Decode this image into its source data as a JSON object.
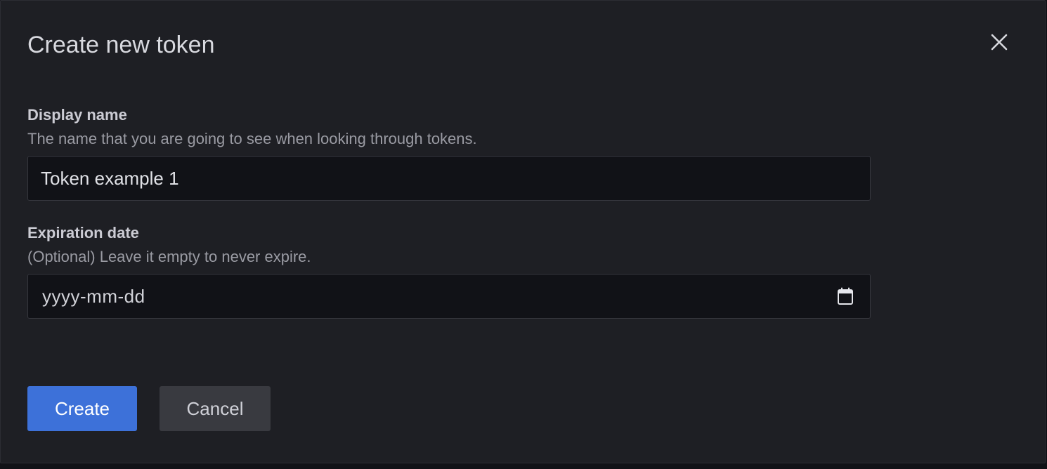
{
  "modal": {
    "title": "Create new token"
  },
  "display_name": {
    "label": "Display name",
    "description": "The name that you are going to see when looking through tokens.",
    "value": "Token example 1"
  },
  "expiration": {
    "label": "Expiration date",
    "description": "(Optional) Leave it empty to never expire.",
    "placeholder": "yyyy-mm-dd"
  },
  "actions": {
    "create_label": "Create",
    "cancel_label": "Cancel"
  },
  "icons": {
    "close": "close-icon",
    "calendar": "calendar-icon"
  },
  "colors": {
    "primary": "#3d71d9",
    "background": "#1e1f24",
    "input_background": "#111217"
  }
}
